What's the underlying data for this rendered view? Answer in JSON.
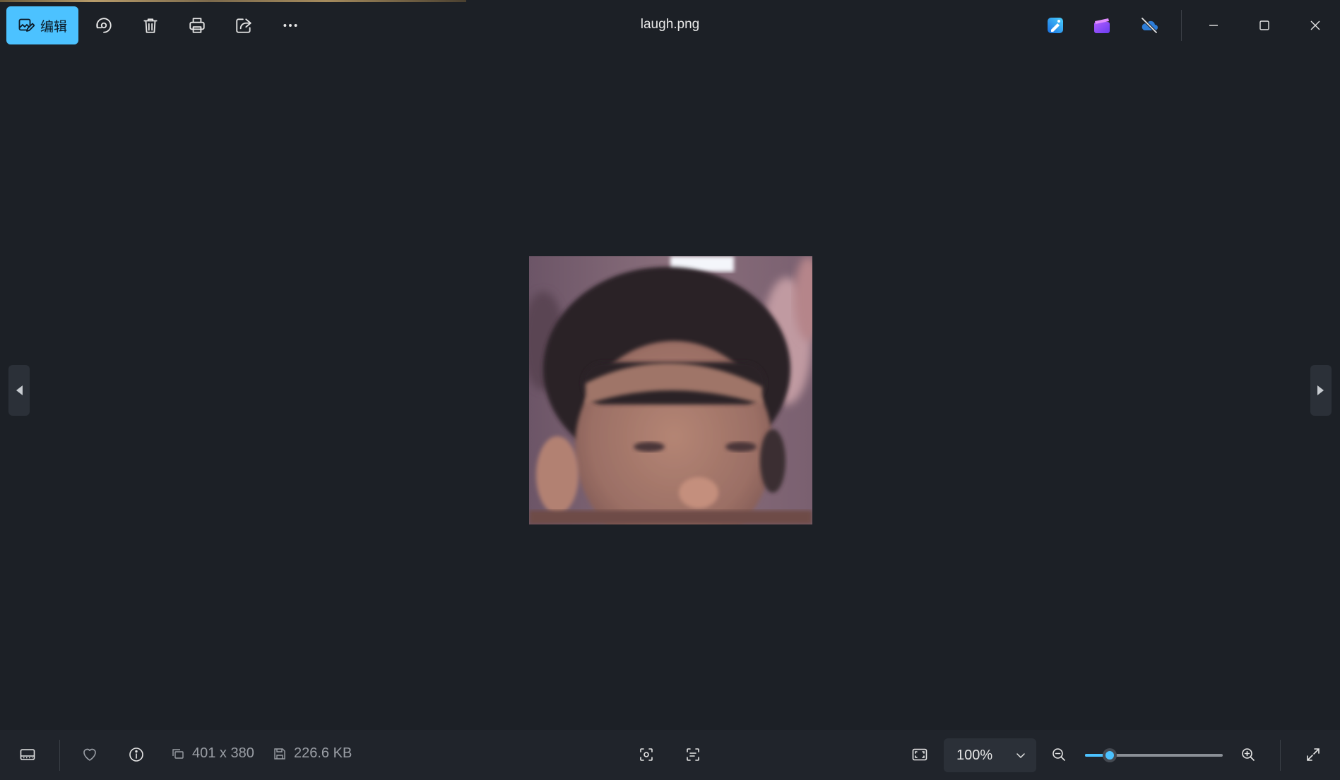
{
  "window": {
    "title": "laugh.png"
  },
  "toolbar": {
    "edit_label": "编辑",
    "icons": [
      "edit-icon",
      "rotate-icon",
      "delete-icon",
      "print-icon",
      "share-icon",
      "more-icon"
    ]
  },
  "title_actions": {
    "icons": [
      "designer-app-icon",
      "clipchamp-app-icon",
      "onedrive-offline-icon"
    ]
  },
  "window_controls": [
    "minimize-icon",
    "maximize-icon",
    "close-icon"
  ],
  "image": {
    "alt": "face photo"
  },
  "status": {
    "dimensions": "401 x 380",
    "file_size": "226.6 KB"
  },
  "zoom": {
    "level_label": "100%",
    "slider_fraction": 0.18
  },
  "colors": {
    "accent": "#4cc2ff",
    "background": "#1c2026",
    "bar": "#20242b"
  }
}
